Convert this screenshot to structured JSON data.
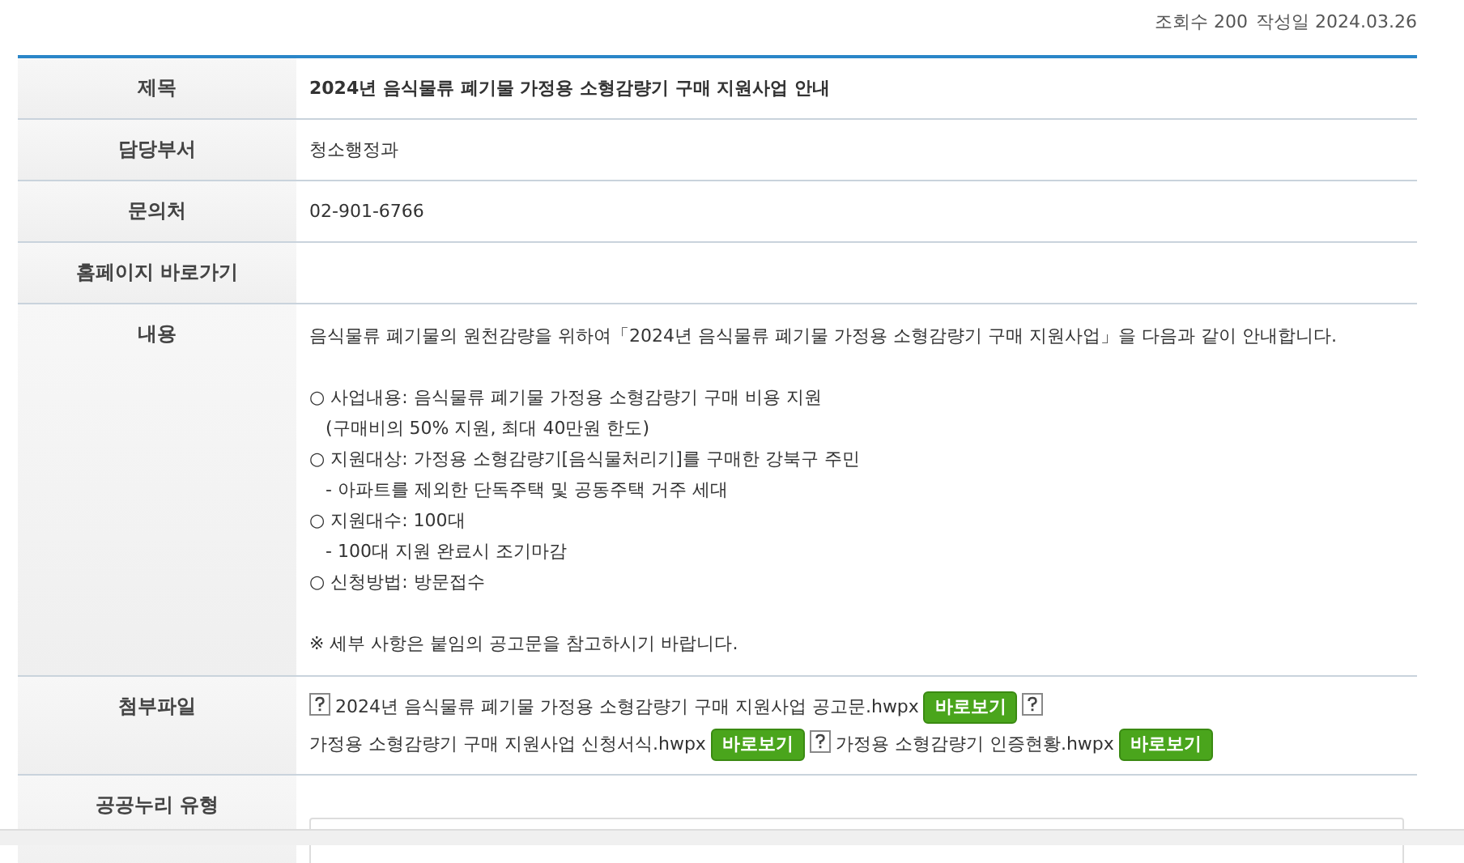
{
  "meta": {
    "views_label": "조회수",
    "views": "200",
    "date_label": "작성일",
    "date": "2024.03.26"
  },
  "rows": [
    {
      "label": "제목",
      "kind": "title",
      "value": "2024년 음식물류 폐기물 가정용 소형감량기 구매 지원사업 안내"
    },
    {
      "label": "담당부서",
      "kind": "text",
      "value": "청소행정과"
    },
    {
      "label": "문의처",
      "kind": "text",
      "value": "02-901-6766"
    },
    {
      "label": "홈페이지 바로가기",
      "kind": "empty"
    },
    {
      "label": "내용",
      "kind": "body",
      "blocks": [
        {
          "items": [
            {
              "text": "음식물류 폐기물의 원천감량을 위하여「2024년 음식물류 폐기물 가정용 소형감량기 구매 지원사업」을 다음과 같이 안내합니다."
            }
          ]
        },
        {
          "items": [
            {
              "text": "○ 사업내용: 음식물류 폐기물 가정용 소형감량기 구매 비용 지원",
              "children": [
                {
                  "text": "(구매비의 50% 지원, 최대 40만원 한도)"
                }
              ]
            },
            {
              "text": "○ 지원대상: 가정용 소형감량기[음식물처리기]를 구매한 강북구 주민",
              "children": [
                {
                  "text": "- 아파트를 제외한 단독주택 및 공동주택 거주 세대"
                }
              ]
            },
            {
              "text": "○ 지원대수: 100대",
              "children": [
                {
                  "text": "- 100대 지원 완료시 조기마감"
                }
              ]
            },
            {
              "text": "○ 신청방법: 방문접수"
            }
          ]
        },
        {
          "items": [
            {
              "text": "※ 세부 사항은 붙임의 공고문을 참고하시기 바랍니다."
            }
          ]
        }
      ]
    },
    {
      "label": "첨부파일",
      "kind": "files",
      "files": [
        {
          "name": "2024년 음식물류 폐기물 가정용 소형감량기 구매 지원사업 공고문.hwpx",
          "button": "바로보기"
        },
        {
          "name": "가정용 소형감량기 구매 지원사업 신청서식.hwpx",
          "button": "바로보기"
        },
        {
          "name": "가정용 소형감량기 인증현황.hwpx",
          "button": "바로보기"
        }
      ]
    },
    {
      "label": "공공누리 유형",
      "kind": "license"
    }
  ]
}
